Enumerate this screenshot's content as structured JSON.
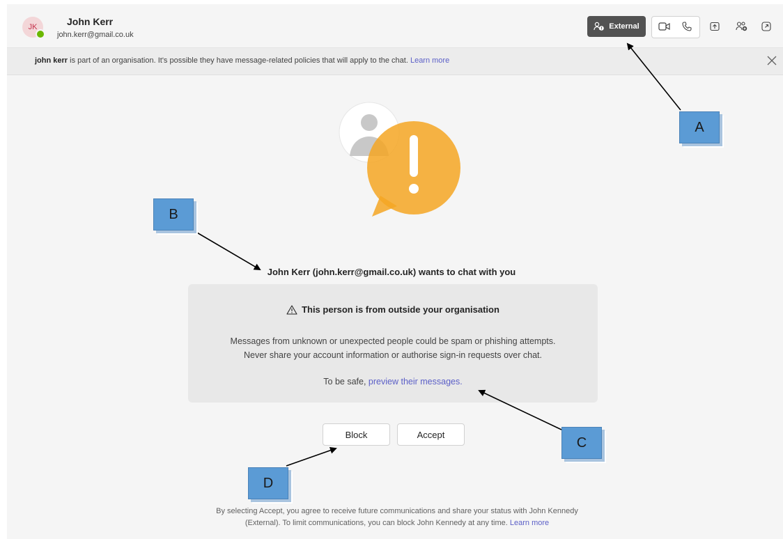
{
  "header": {
    "avatar_initials": "JK",
    "name": "John Kerr",
    "email": "john.kerr@gmail.co.uk",
    "external_label": "External",
    "icons": [
      "people-icon",
      "video-icon",
      "phone-icon",
      "share-screen-icon",
      "add-people-icon",
      "popout-icon"
    ]
  },
  "banner": {
    "name": "john kerr",
    "text": " is part of an organisation. It's possible they have message-related policies that will apply to the chat. ",
    "link": "Learn more"
  },
  "main": {
    "headline": "John Kerr (john.kerr@gmail.co.uk) wants to chat with you",
    "card": {
      "title": "This person is from outside your organisation",
      "line1": "Messages from unknown or unexpected people could be spam or phishing attempts.",
      "line2": "Never share your account information or authorise sign-in requests over chat.",
      "safe_prefix": "To be safe, ",
      "safe_link": "preview their messages."
    },
    "block_label": "Block",
    "accept_label": "Accept",
    "footer_line1": "By selecting Accept, you agree to receive future communications and share your status with John Kennedy",
    "footer_line2_prefix": "(External). To limit communications, you can block John Kennedy at any time. ",
    "footer_link": "Learn more"
  },
  "annotations": {
    "a": "A",
    "b": "B",
    "c": "C",
    "d": "D"
  },
  "colors": {
    "accent": "#5b5fc7",
    "warning": "#f5a623",
    "callout": "#5b9bd5",
    "presence": "#6bb700"
  }
}
